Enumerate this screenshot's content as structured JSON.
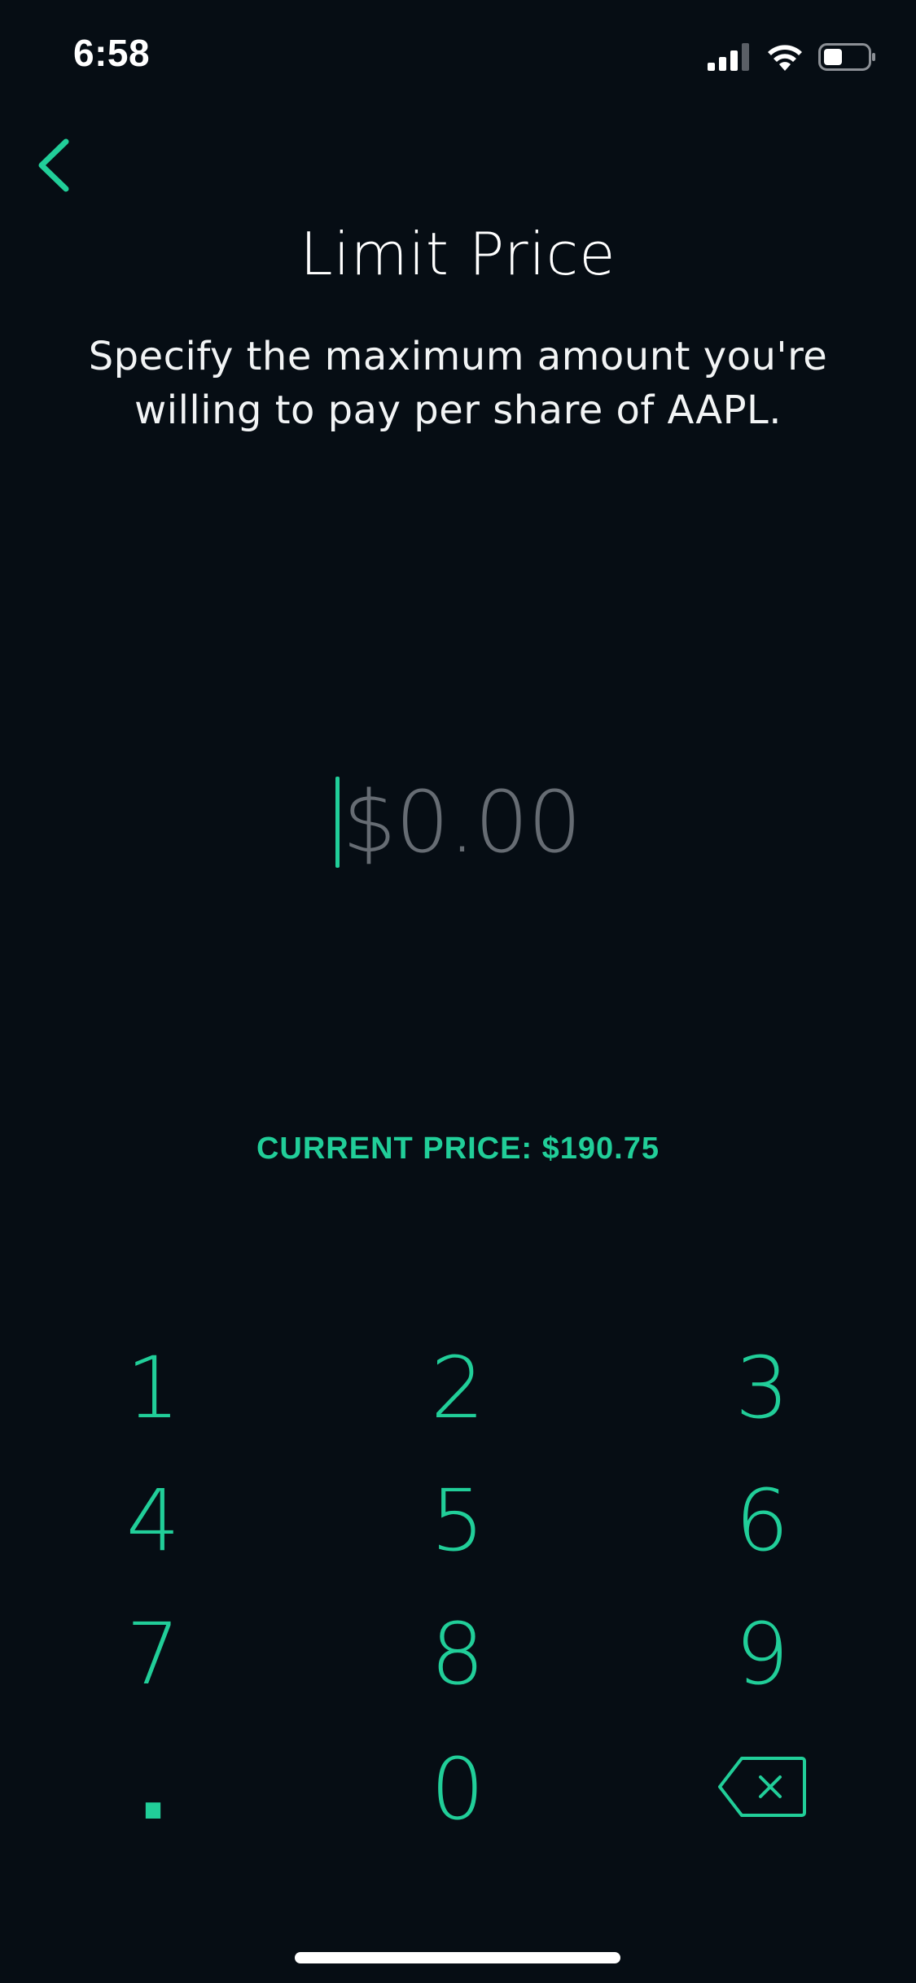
{
  "status_bar": {
    "time": "6:58",
    "icons": [
      "signal-icon",
      "wifi-icon",
      "battery-icon"
    ]
  },
  "nav": {
    "back_icon": "chevron-left-icon"
  },
  "header": {
    "title": "Limit Price",
    "subtitle_line1": "Specify the maximum amount you're",
    "subtitle_line2": "willing to pay per share of AAPL."
  },
  "price_input": {
    "value": "",
    "placeholder": "$0.00"
  },
  "current_price": "CURRENT PRICE: $190.75",
  "keypad": {
    "keys": [
      "1",
      "2",
      "3",
      "4",
      "5",
      "6",
      "7",
      "8",
      "9",
      ".",
      "0"
    ],
    "backspace_icon": "backspace-icon"
  },
  "colors": {
    "accent": "#21ce99",
    "background": "#060d14",
    "placeholder": "#666c73"
  }
}
